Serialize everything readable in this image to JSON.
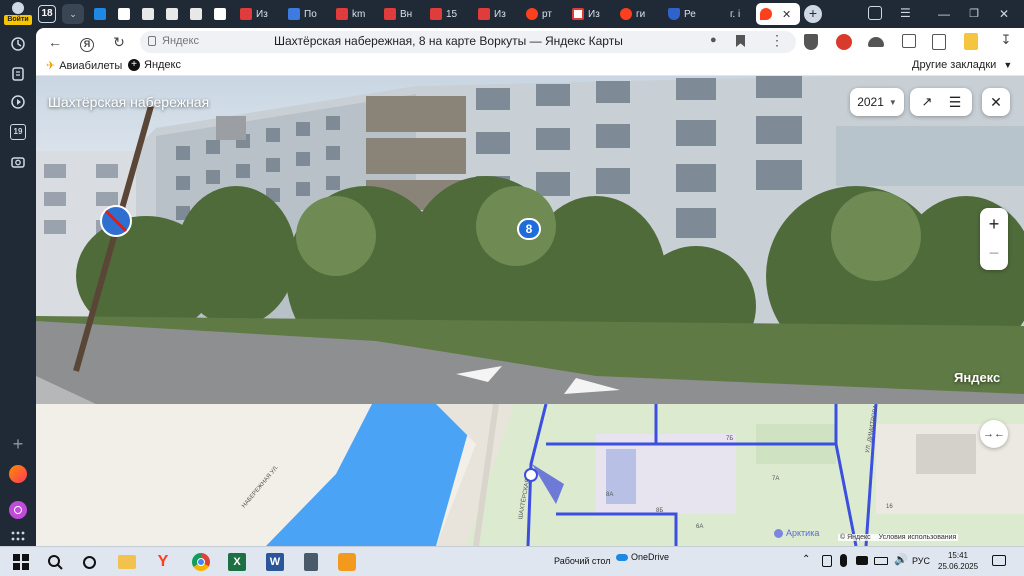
{
  "colors": {
    "sidebar_bg": "#1f2a36",
    "yandex_red": "#fc3f1d",
    "address_pill": "#eff1f4",
    "map_water": "#4aa3f5",
    "map_route": "#3c4fe0",
    "badge_blue": "#1e6ddb"
  },
  "sidebar": {
    "login_label": "Войти",
    "calendar_day": "19",
    "icons": [
      "history-icon",
      "collections-icon",
      "media-icon",
      "calendar-icon",
      "camera-icon",
      "add-icon",
      "alice-icon",
      "purple-app-icon",
      "apps-grid-icon"
    ]
  },
  "tabs": {
    "group_count": "18",
    "items": [
      {
        "label": "Из"
      },
      {
        "label": "По"
      },
      {
        "label": "km"
      },
      {
        "label": "Вн"
      },
      {
        "label": "15"
      },
      {
        "label": "Из"
      },
      {
        "label": "рт"
      },
      {
        "label": "Из"
      },
      {
        "label": "ги"
      },
      {
        "label": "Ре"
      },
      {
        "label": "г. i"
      }
    ]
  },
  "address_bar": {
    "site_label": "Яндекс",
    "page_title": "Шахтёрская набережная, 8 на карте Воркуты — Яндекс Карты"
  },
  "bookmarks": {
    "items": [
      {
        "label": "Авиабилеты"
      },
      {
        "label": "Яндекс"
      }
    ],
    "other": "Другие закладки"
  },
  "panorama": {
    "street_title": "Шахтёрская набережная",
    "year": "2021",
    "house_badge": "8",
    "brand": "Яндекс"
  },
  "map": {
    "street_label_1": "НАБЕРЕЖНАЯ УЛ.",
    "street_label_2": "ШАХТЁРСКАЯ",
    "street_label_3": "УЛ. ДИМИТРОВА",
    "place_label": "Арктика",
    "copyright": "© Яндекс",
    "terms": "Условия использования",
    "house_numbers": [
      "8А",
      "7Б",
      "7А",
      "8Б",
      "6А",
      "16"
    ]
  },
  "taskbar": {
    "desktop_label": "Рабочий стол",
    "onedrive_label": "OneDrive",
    "lang": "РУС",
    "time": "15:41",
    "date": "25.06.2025"
  }
}
